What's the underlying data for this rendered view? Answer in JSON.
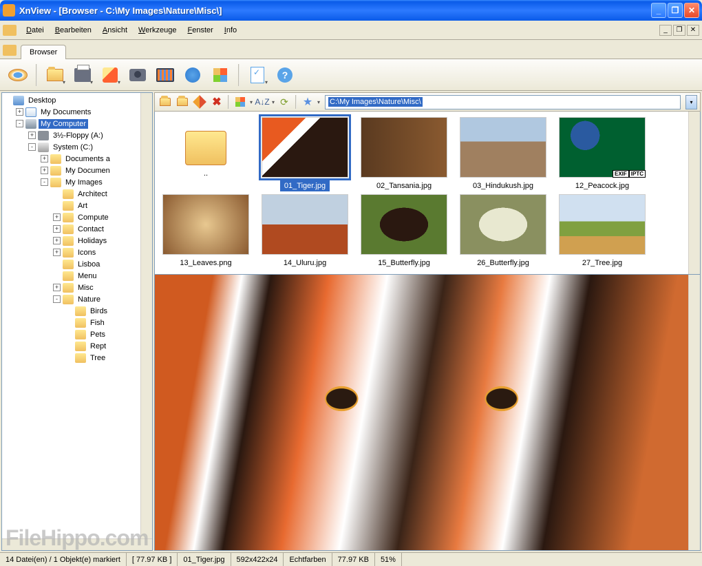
{
  "window": {
    "title": "XnView - [Browser - C:\\My Images\\Nature\\Misc\\]"
  },
  "menubar": {
    "items": [
      {
        "label": "Datei",
        "underline": "D"
      },
      {
        "label": "Bearbeiten",
        "underline": "B"
      },
      {
        "label": "Ansicht",
        "underline": "A"
      },
      {
        "label": "Werkzeuge",
        "underline": "W"
      },
      {
        "label": "Fenster",
        "underline": "F"
      },
      {
        "label": "Info",
        "underline": "I"
      }
    ]
  },
  "tab": {
    "label": "Browser"
  },
  "address": {
    "path": "C:\\My Images\\Nature\\Misc\\"
  },
  "tree": [
    {
      "level": 0,
      "exp": "",
      "icon": "desktop",
      "label": "Desktop"
    },
    {
      "level": 1,
      "exp": "+",
      "icon": "mydocs",
      "label": "My Documents"
    },
    {
      "level": 1,
      "exp": "-",
      "icon": "computer",
      "label": "My Computer",
      "selected": true
    },
    {
      "level": 2,
      "exp": "+",
      "icon": "floppy",
      "label": "3½-Floppy (A:)"
    },
    {
      "level": 2,
      "exp": "-",
      "icon": "drive",
      "label": "System (C:)"
    },
    {
      "level": 3,
      "exp": "+",
      "icon": "folder",
      "label": "Documents a"
    },
    {
      "level": 3,
      "exp": "+",
      "icon": "folder",
      "label": "My Documen"
    },
    {
      "level": 3,
      "exp": "-",
      "icon": "folder",
      "label": "My Images"
    },
    {
      "level": 4,
      "exp": "",
      "icon": "folder",
      "label": "Architect"
    },
    {
      "level": 4,
      "exp": "",
      "icon": "folder",
      "label": "Art"
    },
    {
      "level": 4,
      "exp": "+",
      "icon": "folder",
      "label": "Compute"
    },
    {
      "level": 4,
      "exp": "+",
      "icon": "folder",
      "label": "Contact"
    },
    {
      "level": 4,
      "exp": "+",
      "icon": "folder",
      "label": "Holidays"
    },
    {
      "level": 4,
      "exp": "+",
      "icon": "folder",
      "label": "Icons"
    },
    {
      "level": 4,
      "exp": "",
      "icon": "folder",
      "label": "Lisboa"
    },
    {
      "level": 4,
      "exp": "",
      "icon": "folder",
      "label": "Menu"
    },
    {
      "level": 4,
      "exp": "+",
      "icon": "folder",
      "label": "Misc"
    },
    {
      "level": 4,
      "exp": "-",
      "icon": "folder",
      "label": "Nature"
    },
    {
      "level": 5,
      "exp": "",
      "icon": "folder",
      "label": "Birds"
    },
    {
      "level": 5,
      "exp": "",
      "icon": "folder",
      "label": "Fish"
    },
    {
      "level": 5,
      "exp": "",
      "icon": "folder",
      "label": "Pets"
    },
    {
      "level": 5,
      "exp": "",
      "icon": "folder",
      "label": "Rept"
    },
    {
      "level": 5,
      "exp": "",
      "icon": "folder",
      "label": "Tree"
    }
  ],
  "thumbnails": {
    "parent_label": "..",
    "items": [
      {
        "name": "01_Tiger.jpg",
        "cls": "t-tiger",
        "selected": true
      },
      {
        "name": "02_Tansania.jpg",
        "cls": "t-tansania"
      },
      {
        "name": "03_Hindukush.jpg",
        "cls": "t-hindukush"
      },
      {
        "name": "12_Peacock.jpg",
        "cls": "t-peacock",
        "badges": [
          "EXIF",
          "IPTC"
        ]
      },
      {
        "name": "13_Leaves.png",
        "cls": "t-leaves"
      },
      {
        "name": "14_Uluru.jpg",
        "cls": "t-uluru"
      },
      {
        "name": "15_Butterfly.jpg",
        "cls": "t-butterfly1"
      },
      {
        "name": "26_Butterfly.jpg",
        "cls": "t-butterfly2"
      },
      {
        "name": "27_Tree.jpg",
        "cls": "t-tree"
      }
    ]
  },
  "status": {
    "files": "14 Datei(en) / 1 Objekt(e) markiert",
    "size1": "[ 77.97 KB ]",
    "filename": "01_Tiger.jpg",
    "dims": "592x422x24",
    "colors": "Echtfarben",
    "size2": "77.97 KB",
    "zoom": "51%"
  },
  "watermark": "FileHippo.com"
}
